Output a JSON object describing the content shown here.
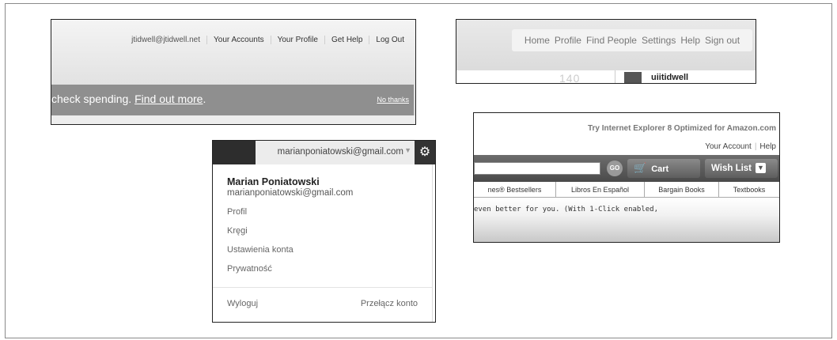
{
  "panel_a": {
    "nav": [
      "jtidwell@jtidwell.net",
      "Your Accounts",
      "Your Profile",
      "Get Help",
      "Log Out"
    ],
    "banner_text": "check spending.",
    "banner_link": "Find out more",
    "banner_period": ".",
    "dismiss": "No thanks"
  },
  "panel_b": {
    "nav": [
      "Home",
      "Profile",
      "Find People",
      "Settings",
      "Help",
      "Sign out"
    ],
    "count": "140",
    "username": "uiitidwell"
  },
  "panel_c": {
    "email": "marianponiatowski@gmail.com",
    "name": "Marian Poniatowski",
    "name_email": "marianponiatowski@gmail.com",
    "items": [
      "Profil",
      "Kręgi",
      "Ustawienia konta",
      "Prywatność"
    ],
    "logout": "Wyloguj",
    "switch_account": "Przełącz konto"
  },
  "panel_d": {
    "promo": "Try Internet Explorer 8 Optimized for Amazon.com",
    "links": [
      "Your Account",
      "Help"
    ],
    "go": "GO",
    "cart": "Cart",
    "wish_list": "Wish List",
    "tabs": [
      "nes® Bestsellers",
      "Libros En Español",
      "Bargain Books",
      "Textbooks"
    ],
    "note": "even better for you. (With 1-Click enabled,"
  }
}
